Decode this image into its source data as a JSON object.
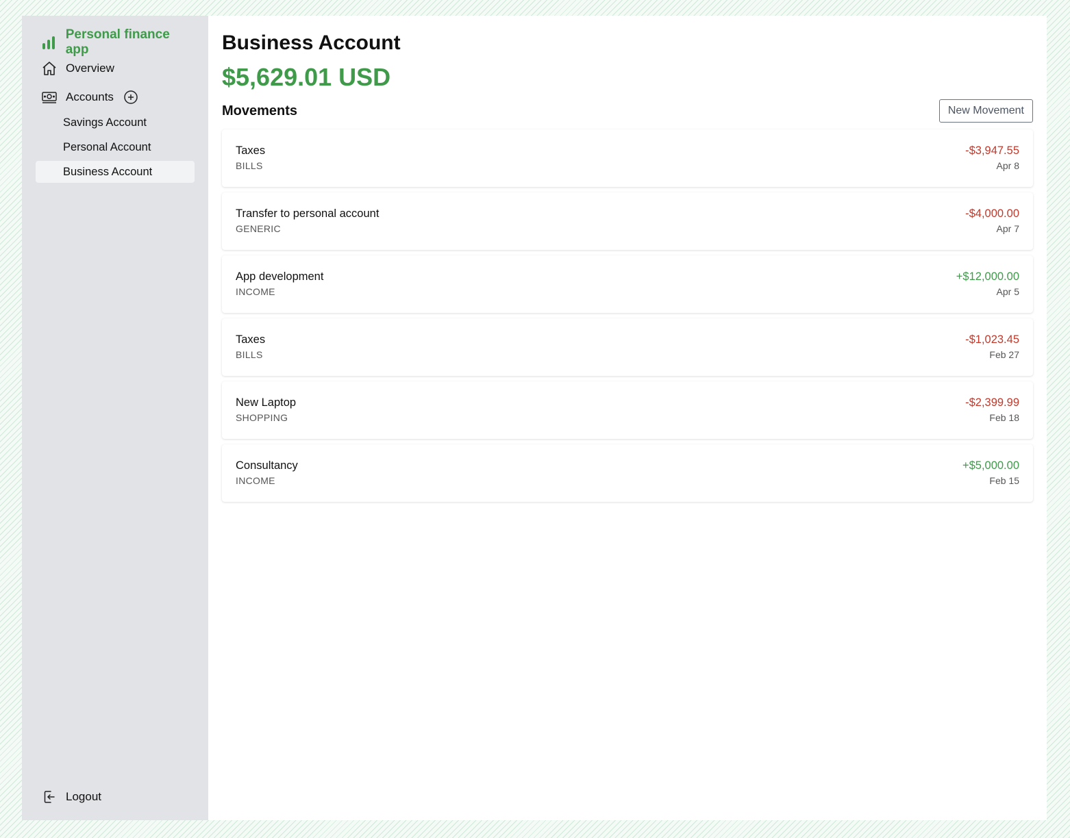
{
  "app": {
    "title": "Personal finance app",
    "accent_color": "#3f9a4a"
  },
  "sidebar": {
    "overview_label": "Overview",
    "accounts_label": "Accounts",
    "accounts": [
      {
        "label": "Savings Account",
        "active": false
      },
      {
        "label": "Personal Account",
        "active": false
      },
      {
        "label": "Business Account",
        "active": true
      }
    ],
    "logout_label": "Logout"
  },
  "main": {
    "title": "Business Account",
    "balance": "$5,629.01 USD",
    "movements_title": "Movements",
    "new_movement_label": "New Movement",
    "movements": [
      {
        "title": "Taxes",
        "category": "BILLS",
        "amount": "-$3,947.55",
        "date": "Apr 8",
        "direction": "neg"
      },
      {
        "title": "Transfer to personal account",
        "category": "GENERIC",
        "amount": "-$4,000.00",
        "date": "Apr 7",
        "direction": "neg"
      },
      {
        "title": "App development",
        "category": "INCOME",
        "amount": "+$12,000.00",
        "date": "Apr 5",
        "direction": "pos"
      },
      {
        "title": "Taxes",
        "category": "BILLS",
        "amount": "-$1,023.45",
        "date": "Feb 27",
        "direction": "neg"
      },
      {
        "title": "New Laptop",
        "category": "SHOPPING",
        "amount": "-$2,399.99",
        "date": "Feb 18",
        "direction": "neg"
      },
      {
        "title": "Consultancy",
        "category": "INCOME",
        "amount": "+$5,000.00",
        "date": "Feb 15",
        "direction": "pos"
      }
    ]
  },
  "colors": {
    "negative": "#c0392b",
    "positive": "#3f9a4a",
    "sidebar_bg": "#e2e3e7"
  },
  "icons": {
    "brand": "bar-chart-icon",
    "overview": "home-icon",
    "accounts": "banknote-icon",
    "add": "plus-circle-icon",
    "logout": "logout-icon"
  }
}
